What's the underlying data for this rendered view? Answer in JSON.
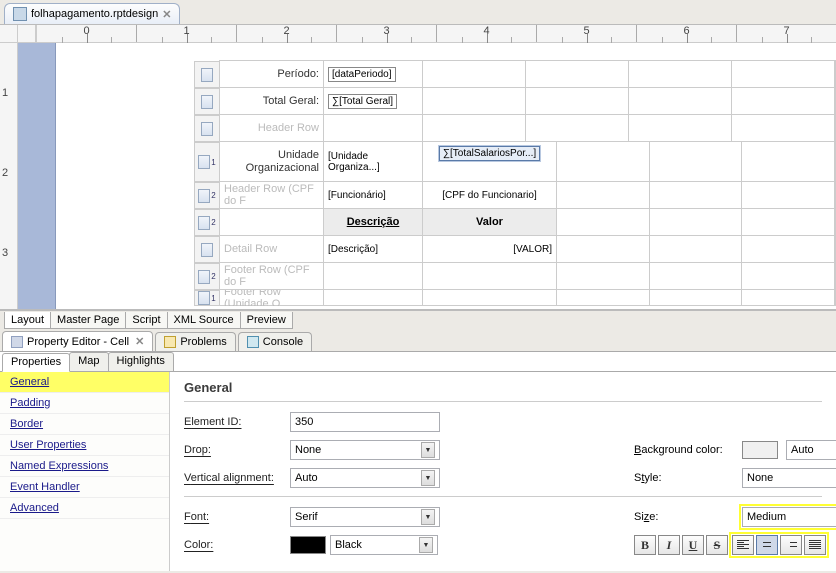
{
  "file_tab": {
    "name": "folhapagamento.rptdesign"
  },
  "ruler": {
    "marks": [
      "0",
      "1",
      "2",
      "3",
      "4",
      "5",
      "6",
      "7"
    ],
    "vmarks": [
      "1",
      "2",
      "3"
    ]
  },
  "rows": {
    "r1": {
      "label": "Período:",
      "value": "[dataPeriodo]"
    },
    "r2": {
      "label": "Total Geral:",
      "value": "∑[Total Geral]"
    },
    "r3": {
      "label": "Header Row"
    },
    "r4": {
      "label1": "Unidade",
      "label2": "Organizacional",
      "val": "[Unidade Organiza...]",
      "sum": "∑[TotalSalariosPor...]",
      "level": "1"
    },
    "r5": {
      "faded": "Header Row (CPF do F",
      "v1": "[Funcionário]",
      "v2": "[CPF do Funcionario]",
      "level": "2"
    },
    "r6": {
      "h1": "Descrição",
      "h2": "Valor",
      "level": "2"
    },
    "r7": {
      "faded": "Detail Row",
      "v1": "[Descrição]",
      "v2": "[VALOR]"
    },
    "r8": {
      "faded": "Footer Row (CPF do F",
      "level": "2"
    },
    "r9": {
      "faded": "Footer Row (Unidade O",
      "level": "1"
    }
  },
  "designer_tabs": [
    "Layout",
    "Master Page",
    "Script",
    "XML Source",
    "Preview"
  ],
  "views": {
    "editor": "Property Editor - Cell",
    "problems": "Problems",
    "console": "Console"
  },
  "prop_tabs": [
    "Properties",
    "Map",
    "Highlights"
  ],
  "side_items": [
    "General",
    "Padding",
    "Border",
    "User Properties",
    "Named Expressions",
    "Event Handler",
    "Advanced"
  ],
  "general": {
    "title": "General",
    "element_id_label": "Element ID:",
    "element_id": "350",
    "drop_label": "Drop:",
    "drop": "None",
    "bgcolor_label": "Background color:",
    "bgcolor": "Auto",
    "valign_label": "Vertical alignment:",
    "valign": "Auto",
    "style_label": "Style:",
    "style": "None",
    "font_label": "Font:",
    "font": "Serif",
    "size_label": "Size:",
    "size": "Medium",
    "color_label": "Color:",
    "color": "Black",
    "btn_bold": "B",
    "btn_italic": "I",
    "btn_underline": "U",
    "btn_strike": "S"
  }
}
